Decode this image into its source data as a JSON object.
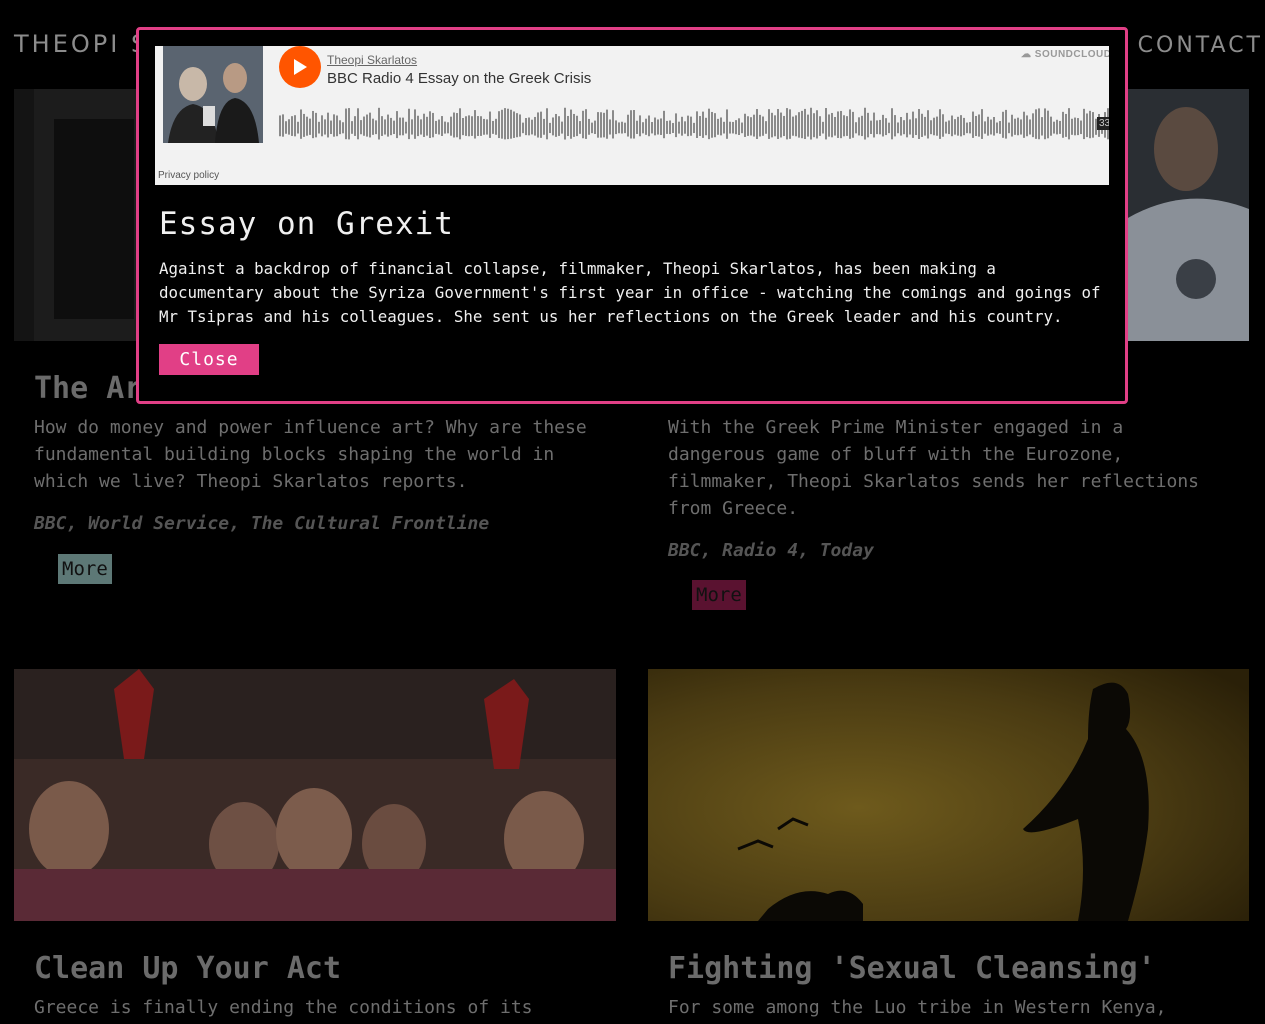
{
  "header": {
    "brand": "THEOPI SK",
    "contact": "CONTACT"
  },
  "cards": [
    {
      "title": "The Ar",
      "description": "How do money and power influence art? Why are these fundamental building blocks shaping the world in which we live? Theopi Skarlatos reports.",
      "source": "BBC, World Service, The Cultural Frontline",
      "more_label": "More",
      "more_color": "#5d7876"
    },
    {
      "title": "",
      "description": "With the Greek Prime Minister engaged in a dangerous game of bluff with the Eurozone, filmmaker, Theopi Skarlatos sends her reflections from Greece.",
      "source": "BBC, Radio 4, Today",
      "more_label": "More",
      "more_color": "#5a1230"
    },
    {
      "title": "Clean Up Your Act",
      "description": "Greece is finally ending the conditions of its",
      "source": "",
      "more_label": ""
    },
    {
      "title": "Fighting 'Sexual Cleansing'",
      "description": "For some among the Luo tribe in Western Kenya,",
      "source": "",
      "more_label": ""
    }
  ],
  "modal": {
    "player": {
      "user": "Theopi Skarlatos",
      "track": "BBC Radio 4 Essay on the Greek Crisis",
      "brand": "SOUNDCLOUD",
      "duration": "33",
      "privacy": "Privacy policy",
      "play_color": "#ff5500"
    },
    "title": "Essay on Grexit",
    "body": "Against a backdrop of financial collapse, filmmaker, Theopi Skarlatos, has been making a documentary about the Syriza Government's first year in office - watching the comings and goings of Mr Tsipras and his colleagues. She sent us her reflections on the Greek leader and his country.",
    "close_label": "Close",
    "accent": "#e13f86"
  }
}
